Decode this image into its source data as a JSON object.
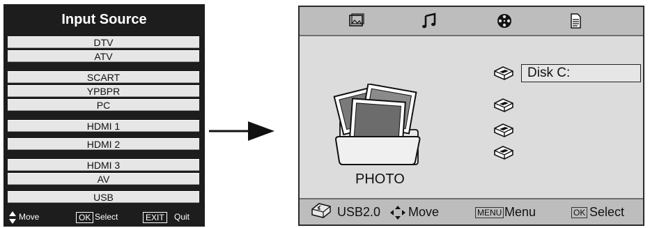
{
  "input_source": {
    "title": "Input Source",
    "items": [
      "DTV",
      "ATV",
      "SCART",
      "YPBPR",
      "PC",
      "HDMI 1",
      "HDMI 2",
      "HDMI 3",
      "AV",
      "USB"
    ],
    "footer": {
      "move": "Move",
      "ok_key": "OK",
      "select": "Select",
      "exit_key": "EXIT",
      "quit": "Quit"
    }
  },
  "media_browser": {
    "tabs": [
      "photo-icon",
      "music-icon",
      "movie-icon",
      "text-icon"
    ],
    "folder_label": "PHOTO",
    "disk_label": "Disk C:",
    "footer": {
      "usb": "USB2.0",
      "move": "Move",
      "menu_key": "MENU",
      "menu": "Menu",
      "ok_key": "OK",
      "select": "Select"
    }
  }
}
